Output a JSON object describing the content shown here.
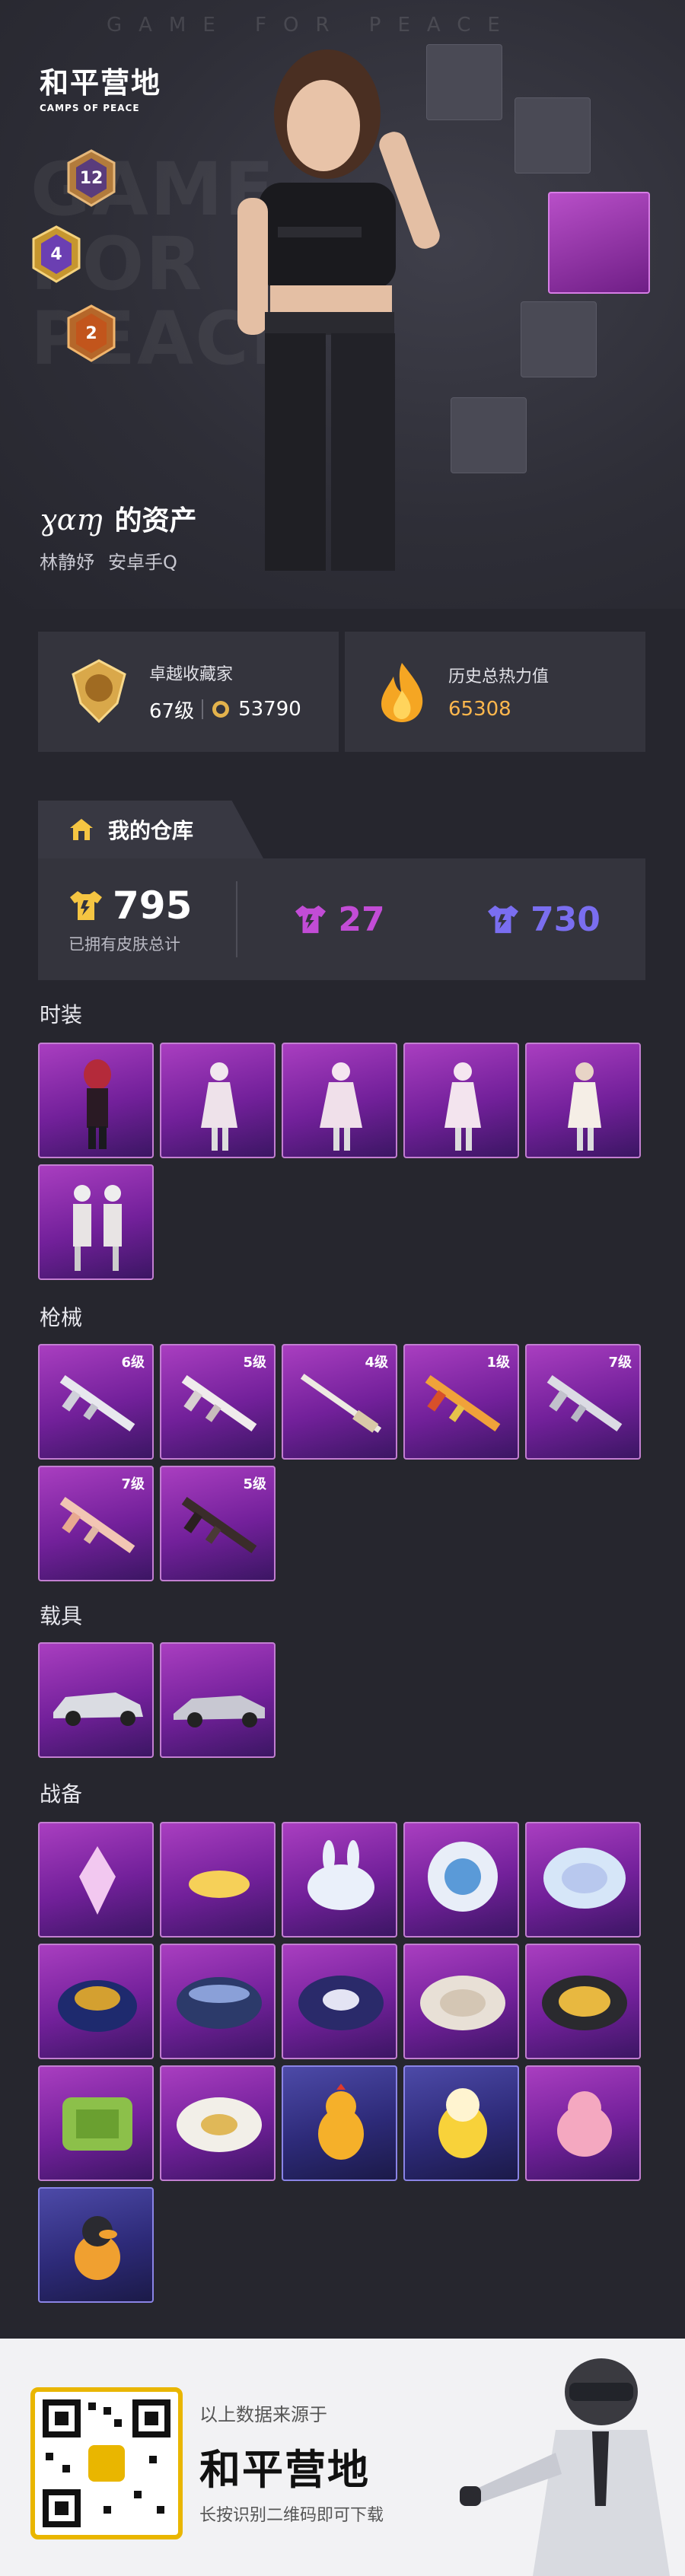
{
  "hero": {
    "top_text": "GAME FOR PEACE",
    "big_text": [
      "GAME",
      "FOR",
      "PEACE"
    ],
    "logo_cn": "和平营地",
    "logo_en": "CAMPS OF PEACE",
    "badges": [
      "12",
      "4",
      "2"
    ]
  },
  "profile": {
    "name": "ɣɑɱ",
    "title": "的资产",
    "server": "林静妤",
    "platform": "安卓手Q"
  },
  "stats": {
    "collector_label": "卓越收藏家",
    "collector_level": "67级",
    "collector_points": "53790",
    "heat_label": "历史总热力值",
    "heat_value": "65308"
  },
  "warehouse": {
    "tab_label": "我的仓库",
    "total": "795",
    "total_label": "已拥有皮肤总计",
    "purple_count": "27",
    "blue_count": "730",
    "colors": {
      "purple": "#c24cd6",
      "blue": "#7a6ef0",
      "gold": "#f5c542"
    }
  },
  "sections": {
    "fashion": "时装",
    "weapons": "枪械",
    "vehicles": "载具",
    "gear": "战备"
  },
  "weapon_grades": [
    "6级",
    "5级",
    "4级",
    "1级",
    "7级",
    "7级",
    "5级"
  ],
  "footer": {
    "source": "以上数据来源于",
    "brand": "和平营地",
    "hint": "长按识别二维码即可下载"
  }
}
